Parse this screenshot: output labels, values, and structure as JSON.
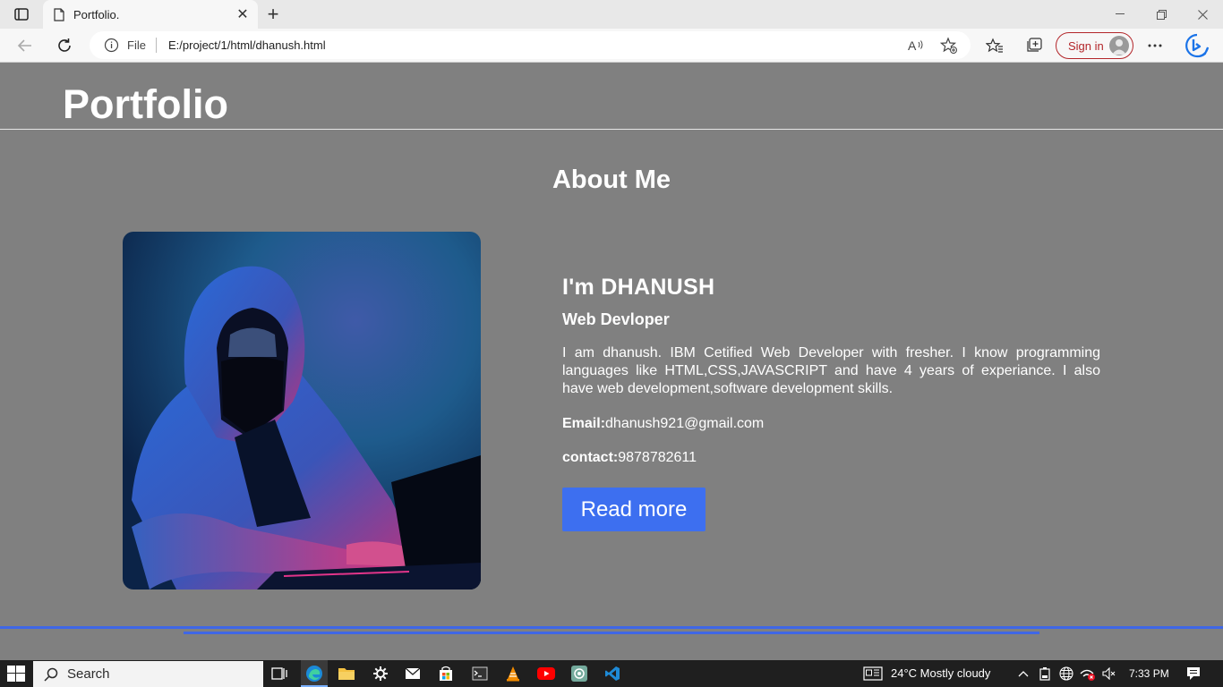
{
  "browser": {
    "tab_title": "Portfolio.",
    "address_scheme_label": "File",
    "address_url": "E:/project/1/html/dhanush.html",
    "signin_label": "Sign in"
  },
  "site": {
    "brand": "Portfolio",
    "section_title": "About Me",
    "name": "I'm DHANUSH",
    "role": "Web Devloper",
    "bio": "I am dhanush. IBM Cetified Web Developer with fresher. I know programming languages like HTML,CSS,JAVASCRIPT and have 4 years of experiance. I also have web development,software development skills.",
    "email_label": "Email:",
    "email_value": "dhanush921@gmail.com",
    "contact_label": "contact:",
    "contact_value": "9878782611",
    "read_more_label": "Read more"
  },
  "taskbar": {
    "search_label": "Search",
    "weather": "24°C  Mostly cloudy",
    "time": "7:33 PM"
  },
  "colors": {
    "page_bg": "#808080",
    "button": "#3d6ff0",
    "rule": "#3f67e6"
  }
}
